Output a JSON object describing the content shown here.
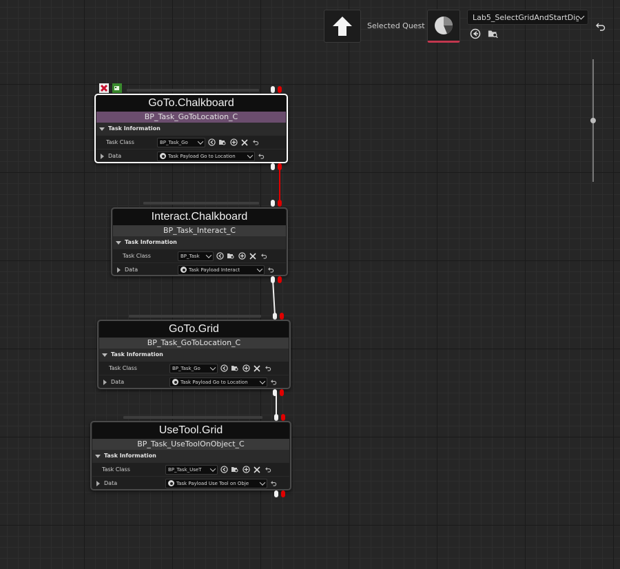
{
  "toolbar": {
    "selected_label": "Selected Quest",
    "quest_value": "Lab5_SelectGridAndStartDig",
    "icons": [
      "up-arrow-icon",
      "pie-chart-icon",
      "use-selected-icon",
      "browse-icon",
      "reset-icon"
    ]
  },
  "section_label": "Task Information",
  "task_class_label": "Task Class",
  "data_label": "Data",
  "nodes": [
    {
      "title": "GoTo.Chalkboard",
      "subtitle": "BP_Task_GoToLocation_C",
      "task_class": "BP_Task_Go",
      "payload": "Task Payload Go to Location"
    },
    {
      "title": "Interact.Chalkboard",
      "subtitle": "BP_Task_Interact_C",
      "task_class": "BP_Task",
      "payload": "Task Payload Interact"
    },
    {
      "title": "GoTo.Grid",
      "subtitle": "BP_Task_GoToLocation_C",
      "task_class": "BP_Task_Go",
      "payload": "Task Payload Go to Location"
    },
    {
      "title": "UseTool.Grid",
      "subtitle": "BP_Task_UseToolOnObject_C",
      "task_class": "BP_Task_UseT",
      "payload": "Task Payload Use Tool on Obje"
    }
  ],
  "colors": {
    "selected_subtitle": "#6b4d6e",
    "exec_wire_red": "#e00000",
    "exec_wire_white": "#f2f2f2",
    "accent_underline": "#c2374e"
  }
}
